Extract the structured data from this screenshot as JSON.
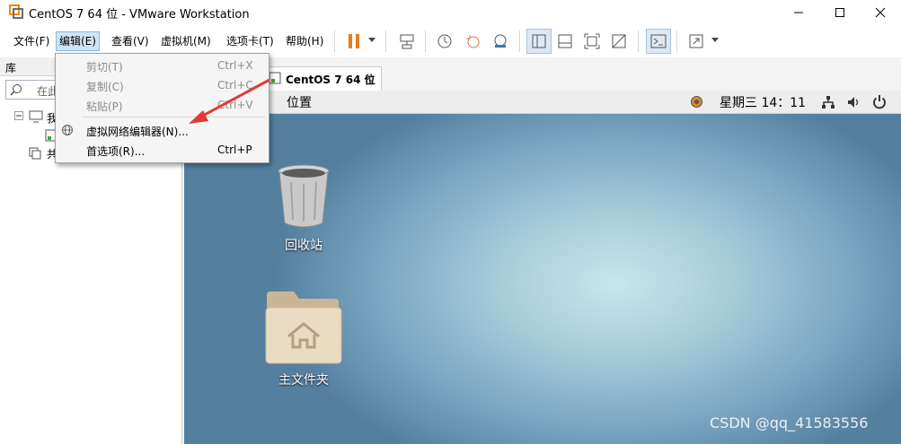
{
  "window": {
    "title": "CentOS 7 64 位 - VMware Workstation"
  },
  "menubar": {
    "items": [
      {
        "label": "文件(F)"
      },
      {
        "label": "编辑(E)"
      },
      {
        "label": "查看(V)"
      },
      {
        "label": "虚拟机(M)"
      },
      {
        "label": "选项卡(T)"
      },
      {
        "label": "帮助(H)"
      }
    ]
  },
  "edit_menu": {
    "items": [
      {
        "label": "剪切(T)",
        "shortcut": "Ctrl+X",
        "enabled": false
      },
      {
        "label": "复制(C)",
        "shortcut": "Ctrl+C",
        "enabled": false
      },
      {
        "label": "粘贴(P)",
        "shortcut": "Ctrl+V",
        "enabled": false
      },
      {
        "label": "虚拟网络编辑器(N)...",
        "shortcut": "",
        "enabled": true
      },
      {
        "label": "首选项(R)...",
        "shortcut": "Ctrl+P",
        "enabled": true
      }
    ]
  },
  "library": {
    "title": "库",
    "search_placeholder": "在此",
    "tree": [
      {
        "label": "我"
      },
      {
        "label": "共"
      }
    ]
  },
  "tabs": [
    {
      "label": "CentOS 7 64 位"
    }
  ],
  "guest": {
    "topbar": {
      "places": "位置",
      "clock": "星期三 14：11"
    },
    "desktop_icons": [
      {
        "label": "回收站"
      },
      {
        "label": "主文件夹"
      }
    ]
  },
  "watermark": "CSDN @qq_41583556",
  "colors": {
    "accent_red": "#e53935",
    "pause_orange": "#f07818",
    "menu_highlight": "#cfe5f7"
  }
}
